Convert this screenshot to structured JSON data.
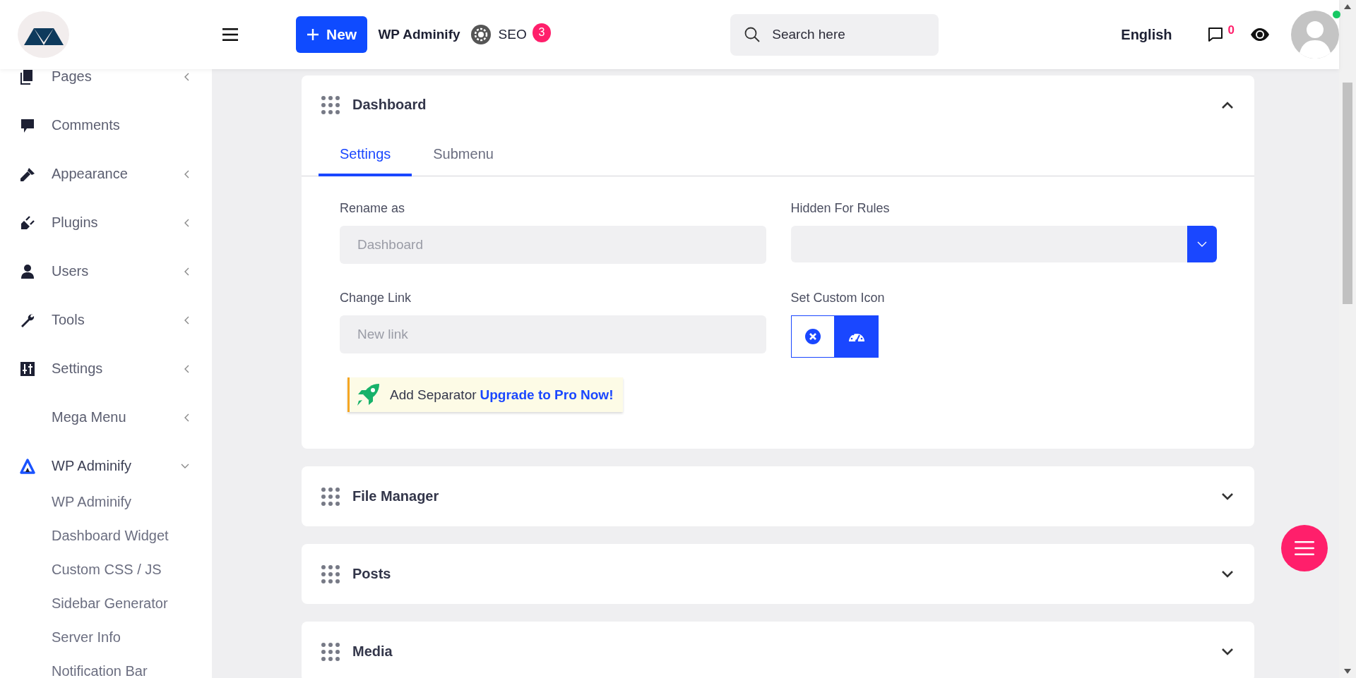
{
  "topbar": {
    "new_button": "New",
    "site_name": "WP Adminify",
    "seo_label": "SEO",
    "seo_badge": "3",
    "search": {
      "placeholder": "Search here"
    },
    "language": "English",
    "comments_badge": "0",
    "user_online": true
  },
  "sidebar": {
    "items": [
      {
        "label": "Pages",
        "expandable": true,
        "expanded": false
      },
      {
        "label": "Comments",
        "expandable": false,
        "expanded": false
      },
      {
        "label": "Appearance",
        "expandable": true,
        "expanded": false
      },
      {
        "label": "Plugins",
        "expandable": true,
        "expanded": false
      },
      {
        "label": "Users",
        "expandable": true,
        "expanded": false
      },
      {
        "label": "Tools",
        "expandable": true,
        "expanded": false
      },
      {
        "label": "Settings",
        "expandable": true,
        "expanded": false
      },
      {
        "label": "Mega Menu",
        "expandable": true,
        "expanded": false
      },
      {
        "label": "WP Adminify",
        "expandable": true,
        "expanded": true,
        "children": [
          {
            "label": "WP Adminify"
          },
          {
            "label": "Dashboard Widget"
          },
          {
            "label": "Custom CSS / JS"
          },
          {
            "label": "Sidebar Generator"
          },
          {
            "label": "Server Info"
          },
          {
            "label": "Notification Bar"
          }
        ]
      }
    ]
  },
  "panels": [
    {
      "title": "Dashboard",
      "expanded": true,
      "tabs": [
        {
          "label": "Settings",
          "selected": true
        },
        {
          "label": "Submenu",
          "selected": false
        }
      ],
      "rename": {
        "label": "Rename as",
        "placeholder": "Dashboard"
      },
      "hidden_for_rules": {
        "label": "Hidden For Rules"
      },
      "change_link": {
        "label": "Change Link",
        "placeholder": "New link"
      },
      "custom_icon": {
        "label": "Set Custom Icon",
        "options": [
          {
            "selected": false
          },
          {
            "selected": true
          }
        ]
      },
      "notice": {
        "text": "Add Separator",
        "link": "Upgrade to Pro Now!"
      }
    },
    {
      "title": "File Manager",
      "expanded": false
    },
    {
      "title": "Posts",
      "expanded": false
    },
    {
      "title": "Media",
      "expanded": false
    }
  ]
}
